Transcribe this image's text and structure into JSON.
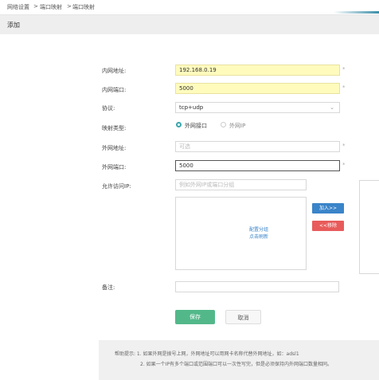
{
  "breadcrumb": {
    "items": [
      "网络设置",
      "端口映射",
      "端口映射"
    ],
    "sep": ">"
  },
  "title": "添加",
  "form": {
    "inner_addr": {
      "label": "内网地址:",
      "value": "192.168.0.19"
    },
    "inner_port": {
      "label": "内网端口:",
      "value": "5000"
    },
    "protocol": {
      "label": "协议:",
      "value": "tcp+udp"
    },
    "map_type": {
      "label": "映射类型:",
      "opt1": "外网接口",
      "opt2": "外网IP"
    },
    "outer_addr": {
      "label": "外网地址:",
      "placeholder": "可选"
    },
    "outer_port": {
      "label": "外网端口:",
      "value": "5000"
    },
    "allow_ip": {
      "label": "允许访问IP:",
      "placeholder": "例如外网IP或端口分组"
    },
    "group_box": {
      "line1": "配置分组",
      "line2": "点击刷新"
    },
    "add_button": "加入>>",
    "remove_button": "<<移除",
    "remark": {
      "label": "备注:"
    }
  },
  "actions": {
    "save": "保存",
    "cancel": "取消"
  },
  "tip": {
    "line1": "帮助提示: 1. 如果外网是拨号上网，外网地址可以用网卡名称代替外网地址，如：adsl1",
    "line2": "2. 如果一个IP有多个端口或范围端口可以一次性写完，但是必须保持内外网端口数量相同。"
  },
  "colors": {
    "accent": "#3aa6ad",
    "save": "#52b88a",
    "remove": "#e85b5b",
    "add": "#3a84c9",
    "highlight": "#fffbbd"
  }
}
